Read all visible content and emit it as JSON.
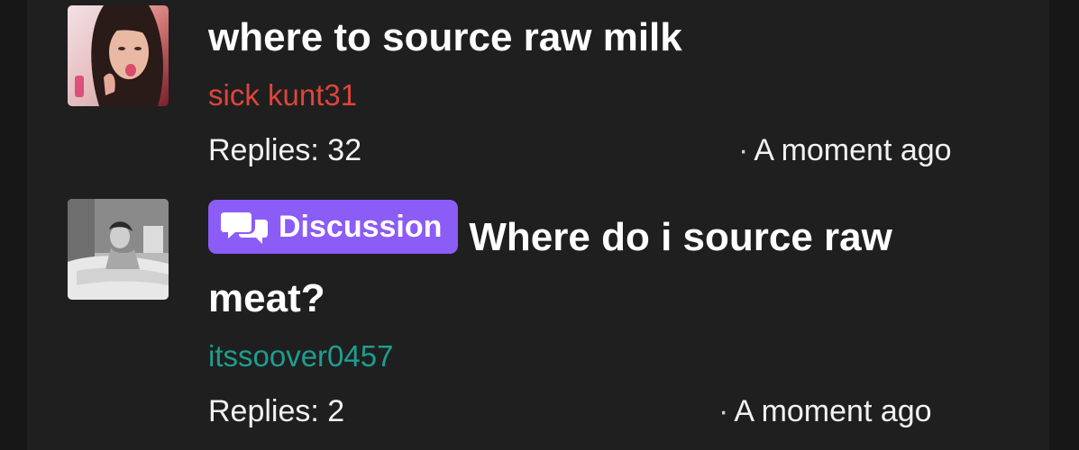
{
  "threads": [
    {
      "title": "where to source raw milk",
      "author": "sick kunt31",
      "author_color": "#e0453a",
      "replies": "Replies: 32",
      "time_sep": "·",
      "time": "A moment ago",
      "avatar": "profile-photo"
    },
    {
      "tag": {
        "label": "Discussion",
        "icon": "chat-bubbles-icon",
        "color": "#8b5cf6"
      },
      "title": "Where do i source raw meat?",
      "author": "itssoover0457",
      "author_color": "#1d9e8f",
      "replies": "Replies: 2",
      "time_sep": "·",
      "time": "A moment ago",
      "avatar": "profile-photo-bw"
    }
  ]
}
